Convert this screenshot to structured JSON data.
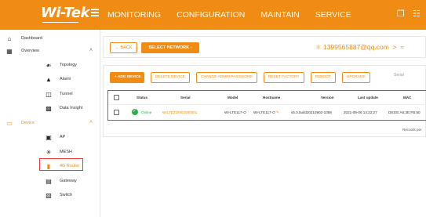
{
  "topbar": {
    "logo": "Wi-Tek",
    "nav": [
      "MONITORING",
      "CONFIGURATION",
      "MAINTAIN",
      "SERVICE"
    ]
  },
  "sidebar": {
    "items": [
      {
        "label": "Dashboard",
        "icon": "home-icon"
      },
      {
        "label": "Overview",
        "icon": "building-icon"
      },
      {
        "label": "Topology",
        "icon": "topology-icon"
      },
      {
        "label": "Alarm",
        "icon": "bell-icon"
      },
      {
        "label": "Tunnel",
        "icon": "tunnel-icon"
      },
      {
        "label": "Data Insight",
        "icon": "chart-icon"
      },
      {
        "label": "Device",
        "icon": "device-icon"
      },
      {
        "label": "AP",
        "icon": "ap-icon"
      },
      {
        "label": "MESH",
        "icon": "mesh-icon"
      },
      {
        "label": "4G Router",
        "icon": "router-icon"
      },
      {
        "label": "Gateway",
        "icon": "gateway-icon"
      },
      {
        "label": "Switch",
        "icon": "switch-icon"
      }
    ]
  },
  "breadcrumb": {
    "back_label": "BACK",
    "select_network_label": "SELECT NETWORK",
    "user": "1399565887@qq.com"
  },
  "toolbar": {
    "add_device": "ADD DEVICE",
    "delete_device": "DELETE DEVICE",
    "change_password": "CHANGE ADMIN PASSWORD",
    "reset_factory": "RESET FACTORY",
    "reboot": "REBOOT",
    "upgrade": "UPGRADE",
    "serial_placeholder": "Serial"
  },
  "table": {
    "headers": [
      "Status",
      "Serial",
      "Model",
      "Hostname",
      "Version",
      "Last update",
      "MAC"
    ],
    "row": {
      "status": "Online",
      "serial": "WILTE210902000001",
      "model": "WI-LTE117-O",
      "hostname": "WI-LTE117-O",
      "version": "v5.0.build20210902-1059",
      "last_update": "2021-09-06 14:22:27",
      "mac": "D8:EE:A6:3E:FB:50"
    },
    "records_label": "Records per"
  },
  "colors": {
    "brand": "#f08c14",
    "online": "#2eae4f",
    "highlight": "#e53935"
  }
}
